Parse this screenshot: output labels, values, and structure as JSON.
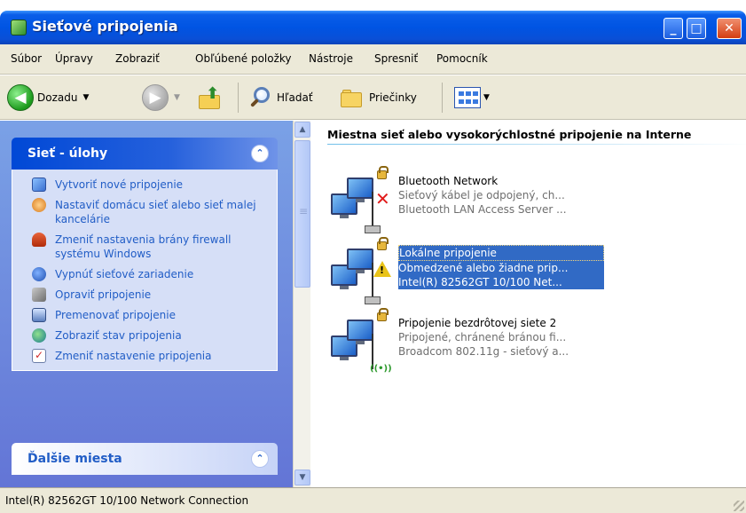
{
  "window": {
    "title": "Sieťové pripojenia",
    "controls": {
      "minimize_icon": "minimize-icon",
      "maximize_icon": "maximize-icon",
      "close_icon": "close-icon"
    }
  },
  "menu": [
    "Súbor",
    "Úpravy",
    "Zobraziť",
    "Obľúbené položky",
    "Nástroje",
    "Spresniť",
    "Pomocník"
  ],
  "toolbar": {
    "back_label": "Dozadu",
    "search_label": "Hľadať",
    "folders_label": "Priečinky"
  },
  "tasks_panel": {
    "title": "Sieť - úlohy",
    "items": [
      {
        "label": "Vytvoriť nové pripojenie",
        "icon": "new-connection-icon"
      },
      {
        "label": "Nastaviť domácu sieť alebo sieť malej kancelárie",
        "icon": "home-network-icon"
      },
      {
        "label": "Zmeniť nastavenia brány firewall systému Windows",
        "icon": "firewall-icon"
      },
      {
        "label": "Vypnúť sieťové zariadenie",
        "icon": "disable-device-icon"
      },
      {
        "label": "Opraviť pripojenie",
        "icon": "repair-icon"
      },
      {
        "label": "Premenovať pripojenie",
        "icon": "rename-icon"
      },
      {
        "label": "Zobraziť stav pripojenia",
        "icon": "status-icon"
      },
      {
        "label": "Zmeniť nastavenie pripojenia",
        "icon": "settings-icon"
      }
    ]
  },
  "other_places_panel": {
    "title": "Ďalšie miesta"
  },
  "content": {
    "group_title": "Miestna sieť alebo vysokorýchlostné pripojenie na Interne",
    "connections": [
      {
        "name": "Bluetooth Network",
        "status": "Sieťový kábel je odpojený, ch...",
        "device": "Bluetooth LAN Access Server ...",
        "selected": false,
        "status_icon": "disconnected-x-icon"
      },
      {
        "name": "Lokálne pripojenie",
        "status": "Obmedzené alebo žiadne prip...",
        "device": "Intel(R) 82562GT 10/100 Net...",
        "selected": true,
        "status_icon": "warning-icon"
      },
      {
        "name": "Pripojenie bezdrôtovej siete 2",
        "status": "Pripojené, chránené bránou fi...",
        "device": "Broadcom 802.11g - sieťový a...",
        "selected": false,
        "status_icon": "wireless-icon"
      }
    ]
  },
  "statusbar": {
    "text": "Intel(R) 82562GT 10/100 Network Connection"
  },
  "colors": {
    "titlebar": "#0054e3",
    "taskpane": "#7aa1e6",
    "selection": "#316ac5",
    "link": "#215dc6"
  }
}
